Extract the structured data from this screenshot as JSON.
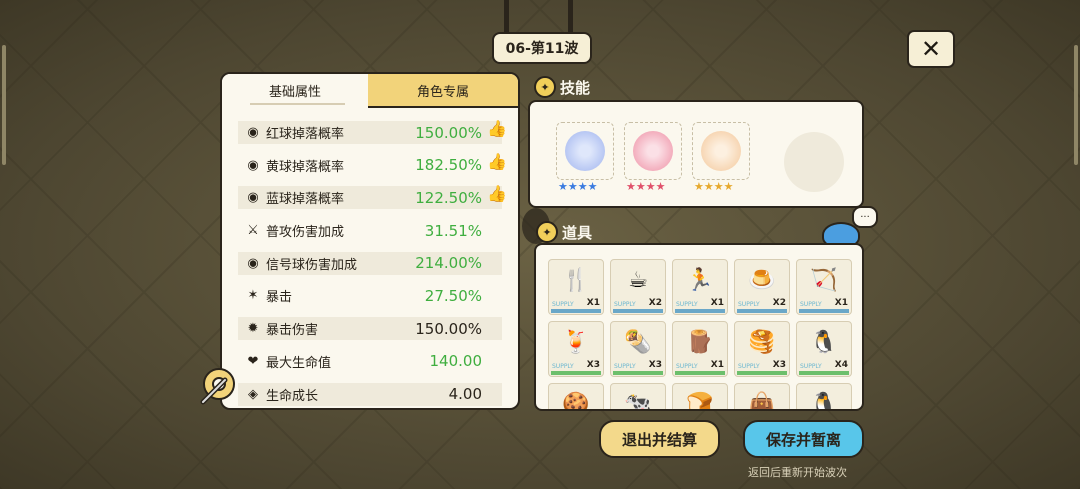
{
  "header": {
    "wave_label": "06-第11波",
    "close_label": "✕"
  },
  "tabs": [
    {
      "label": "基础属性",
      "active": true
    },
    {
      "label": "角色专属",
      "active": false
    }
  ],
  "stats": [
    {
      "icon": "ball-icon",
      "label": "红球掉落概率",
      "value": "150.00%",
      "color": "green",
      "thumb": true
    },
    {
      "icon": "ball-icon",
      "label": "黄球掉落概率",
      "value": "182.50%",
      "color": "green",
      "thumb": true
    },
    {
      "icon": "ball-icon",
      "label": "蓝球掉落概率",
      "value": "122.50%",
      "color": "green",
      "thumb": true
    },
    {
      "icon": "sword-icon",
      "label": "普攻伤害加成",
      "value": "31.51%",
      "color": "green",
      "thumb": false
    },
    {
      "icon": "signal-icon",
      "label": "信号球伤害加成",
      "value": "214.00%",
      "color": "green",
      "thumb": false
    },
    {
      "icon": "crit-icon",
      "label": "暴击",
      "value": "27.50%",
      "color": "green",
      "thumb": false
    },
    {
      "icon": "crit-dmg-icon",
      "label": "暴击伤害",
      "value": "150.00%",
      "color": "black",
      "thumb": false
    },
    {
      "icon": "heart-icon",
      "label": "最大生命值",
      "value": "140.00",
      "color": "green",
      "thumb": false
    },
    {
      "icon": "growth-icon",
      "label": "生命成长",
      "value": "4.00",
      "color": "black",
      "thumb": false
    }
  ],
  "skills": {
    "title": "技能",
    "items": [
      {
        "name": "skill-blue",
        "color_inner": "#dfe7fb",
        "color_outer": "#9fb3ee",
        "stars": "★★★★",
        "star_color": "#3a7be0"
      },
      {
        "name": "skill-red",
        "color_inner": "#fbe0e6",
        "color_outer": "#ee8fa4",
        "stars": "★★★★",
        "star_color": "#e0506a"
      },
      {
        "name": "skill-gold",
        "color_inner": "#fdf0e0",
        "color_outer": "#f3c79a",
        "stars": "★★★★",
        "star_color": "#e6a92e"
      }
    ]
  },
  "items_section": {
    "title": "道具",
    "supply_label": "SUPPLY",
    "items": [
      {
        "glyph": "🍴",
        "qty": "X1",
        "bar": "blue"
      },
      {
        "glyph": "☕",
        "qty": "X2",
        "bar": "blue"
      },
      {
        "glyph": "🏃",
        "qty": "X1",
        "bar": "blue"
      },
      {
        "glyph": "🍮",
        "qty": "X2",
        "bar": "blue"
      },
      {
        "glyph": "🏹",
        "qty": "X1",
        "bar": "blue"
      },
      {
        "glyph": "🍹",
        "qty": "X3",
        "bar": "green"
      },
      {
        "glyph": "🌯",
        "qty": "X3",
        "bar": "green"
      },
      {
        "glyph": "🪵",
        "qty": "X1",
        "bar": "green"
      },
      {
        "glyph": "🥞",
        "qty": "X3",
        "bar": "green"
      },
      {
        "glyph": "🐧",
        "qty": "X4",
        "bar": "green"
      },
      {
        "glyph": "🍪",
        "qty": "",
        "bar": "blue"
      },
      {
        "glyph": "🐄",
        "qty": "",
        "bar": "blue"
      },
      {
        "glyph": "🍞",
        "qty": "",
        "bar": "blue"
      },
      {
        "glyph": "👜",
        "qty": "",
        "bar": "blue"
      },
      {
        "glyph": "🐧",
        "qty": "",
        "bar": "blue"
      }
    ]
  },
  "chat_bubble": "···",
  "buttons": {
    "exit": "退出并结算",
    "save": "保存并暂离"
  },
  "hint": "返回后重新开始波次"
}
